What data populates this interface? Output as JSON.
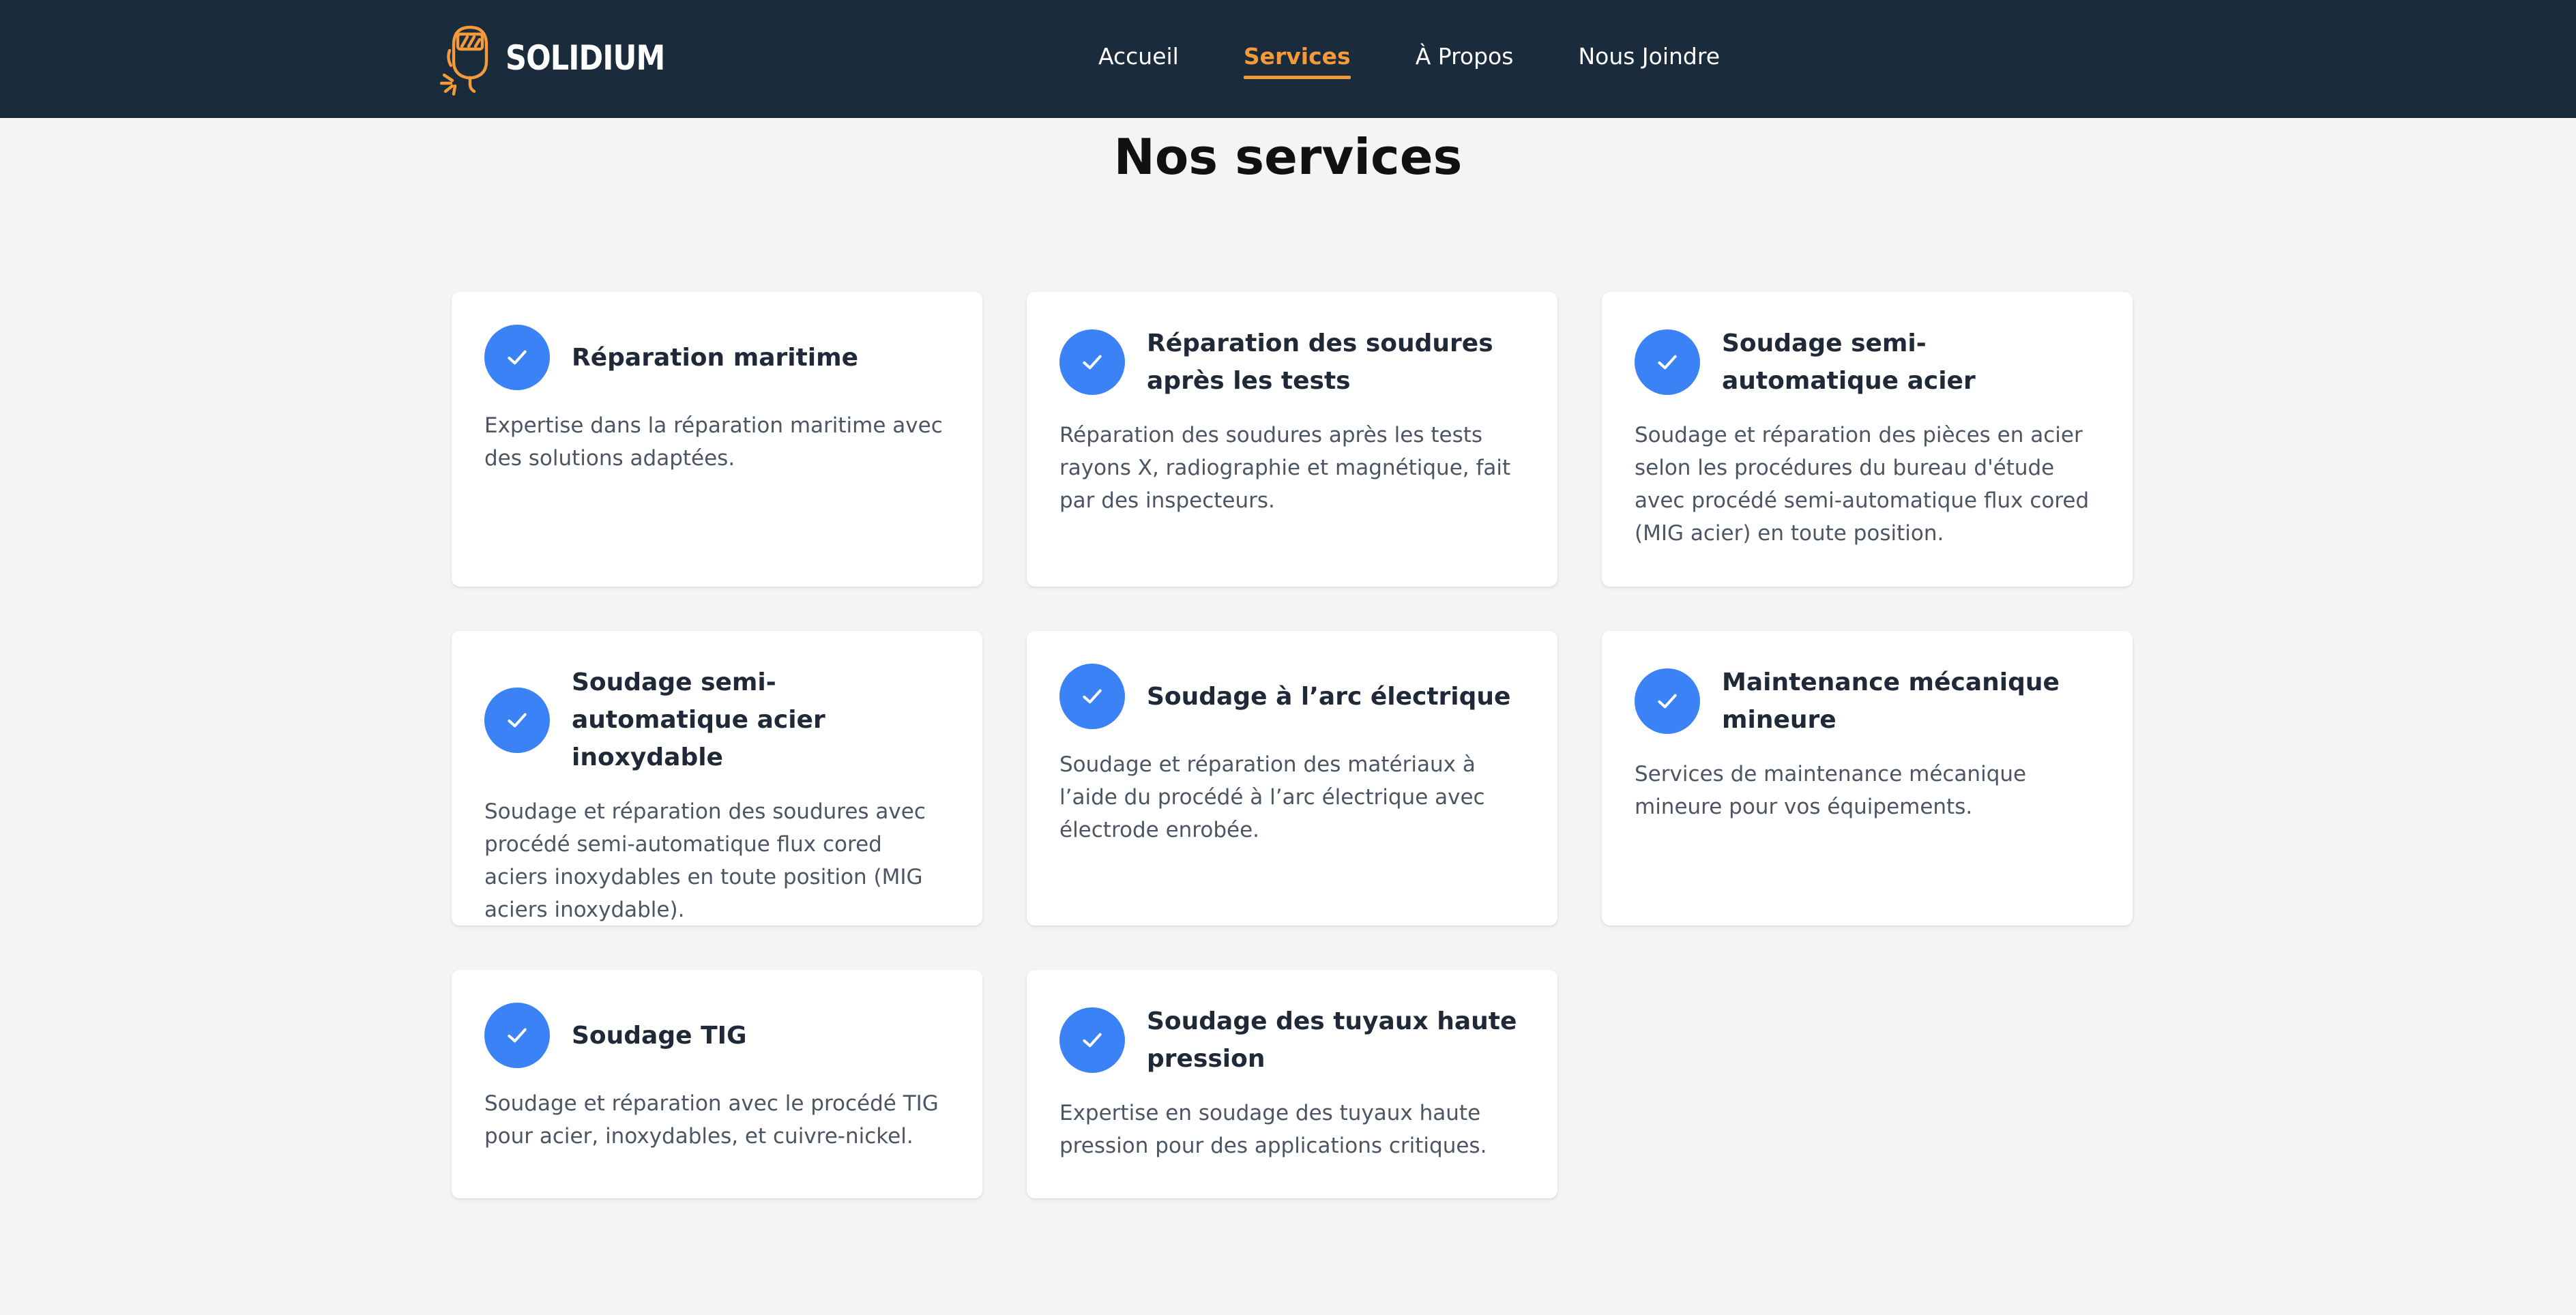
{
  "header": {
    "brand": "SOLIDIUM",
    "logo_icon": "welder-mask-icon",
    "brand_color": "#f59a3b",
    "nav": [
      {
        "label": "Accueil",
        "active": false
      },
      {
        "label": "Services",
        "active": true
      },
      {
        "label": "À Propos",
        "active": false
      },
      {
        "label": "Nous Joindre",
        "active": false
      }
    ]
  },
  "main": {
    "title": "Nos services",
    "services": [
      {
        "title": "Réparation maritime",
        "description": "Expertise dans la réparation maritime avec des solutions adaptées."
      },
      {
        "title": "Réparation des soudures après les tests",
        "description": "Réparation des soudures après les tests rayons X, radiographie et magnétique, fait par des inspecteurs."
      },
      {
        "title": "Soudage semi-automatique acier",
        "description": "Soudage et réparation des pièces en acier selon les procédures du bureau d'étude avec procédé semi-automatique flux cored (MIG acier) en toute position."
      },
      {
        "title": "Soudage semi-automatique acier inoxydable",
        "description": "Soudage et réparation des soudures avec procédé semi-automatique flux cored aciers inoxydables en toute position (MIG aciers inoxydable)."
      },
      {
        "title": "Soudage à l’arc électrique",
        "description": "Soudage et réparation des matériaux à l’aide du procédé à l’arc électrique avec électrode enrobée."
      },
      {
        "title": "Maintenance mécanique mineure",
        "description": "Services de maintenance mécanique mineure pour vos équipements."
      },
      {
        "title": "Soudage TIG",
        "description": "Soudage et réparation avec le procédé TIG pour acier, inoxydables, et cuivre-nickel."
      },
      {
        "title": "Soudage des tuyaux haute pression",
        "description": "Expertise en soudage des tuyaux haute pression pour des applications critiques."
      }
    ],
    "check_icon": "check-icon",
    "accent_color": "#3b82f6"
  }
}
